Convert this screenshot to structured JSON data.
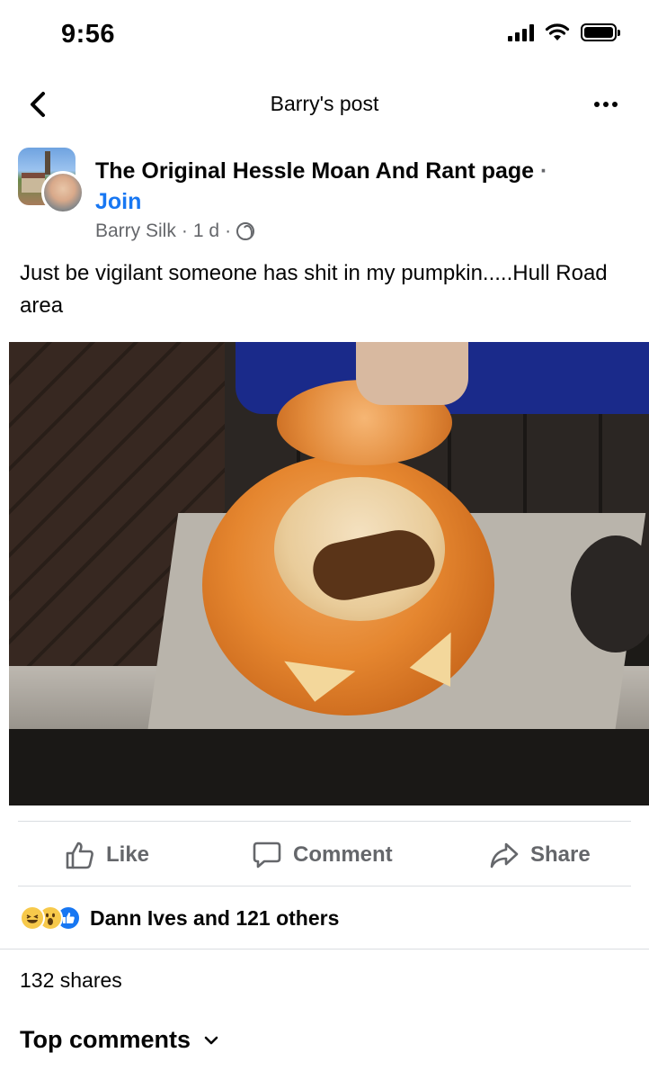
{
  "status_bar": {
    "time": "9:56"
  },
  "nav": {
    "title": "Barry's post"
  },
  "post": {
    "group_name": "The Original Hessle Moan And Rant page",
    "separator": "·",
    "join_label": "Join",
    "author": "Barry Silk",
    "time_ago": "1 d",
    "meta_separator": "·",
    "privacy_icon": "globe-icon",
    "text": "Just be vigilant someone has shit in my pumpkin.....Hull Road area"
  },
  "actions": {
    "like_label": "Like",
    "comment_label": "Comment",
    "share_label": "Share"
  },
  "reactions": {
    "icons": [
      "haha-reaction-icon",
      "wow-reaction-icon",
      "like-reaction-icon"
    ],
    "summary": "Dann Ives and 121 others"
  },
  "shares": {
    "text": "132 shares"
  },
  "comments": {
    "sort_label": "Top comments"
  },
  "colors": {
    "accent": "#1877f2",
    "secondary_text": "#65676b"
  }
}
